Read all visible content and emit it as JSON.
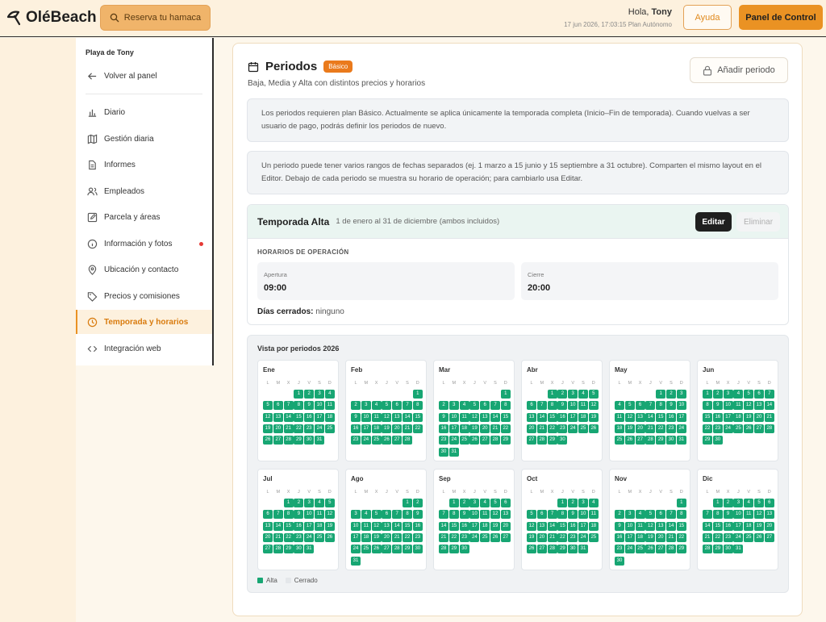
{
  "brand": {
    "name": "OléBeach"
  },
  "header": {
    "reserve_label": "Reserva tu hamaca",
    "greeting_prefix": "Hola,",
    "user_name": "Tony",
    "datetime": "17 jun 2026, 17:03:15",
    "plan": "Plan Autónomo",
    "help_label": "Ayuda",
    "panel_label": "Panel de Control"
  },
  "sidebar": {
    "title": "Playa de Tony",
    "back_label": "Volver al panel",
    "items": [
      {
        "label": "Diario",
        "icon": "bar-chart-icon"
      },
      {
        "label": "Gestión diaria",
        "icon": "map-icon"
      },
      {
        "label": "Informes",
        "icon": "document-icon"
      },
      {
        "label": "Empleados",
        "icon": "users-icon"
      },
      {
        "label": "Parcela y áreas",
        "icon": "edit-icon"
      },
      {
        "label": "Información y fotos",
        "icon": "info-icon"
      },
      {
        "label": "Ubicación y contacto",
        "icon": "location-icon"
      },
      {
        "label": "Precios y comisiones",
        "icon": "tag-icon"
      },
      {
        "label": "Temporada y horarios",
        "icon": "clock-icon"
      },
      {
        "label": "Integración web",
        "icon": "code-icon"
      }
    ]
  },
  "main": {
    "title": "Periodos",
    "badge": "Básico",
    "subtitle": "Baja, Media y Alta con distintos precios y horarios",
    "add_label": "Añadir periodo",
    "info1": "Los periodos requieren plan Básico. Actualmente se aplica únicamente la temporada completa (Inicio–Fin de temporada). Cuando vuelvas a ser usuario de pago, podrás definir los periodos de nuevo.",
    "info2": "Un periodo puede tener varios rangos de fechas separados (ej. 1 marzo a 15 junio y 15 septiembre a 31 octubre). Comparten el mismo layout en el Editor. Debajo de cada periodo se muestra su horario de operación; para cambiarlo usa Editar.",
    "period": {
      "name": "Temporada Alta",
      "range": "1 de enero al 31 de diciembre (ambos incluidos)",
      "edit_label": "Editar",
      "delete_label": "Eliminar",
      "hours_label": "HORARIOS DE OPERACIÓN",
      "open_label": "Apertura",
      "open_value": "09:00",
      "close_label": "Cierre",
      "close_value": "20:00",
      "closed_label": "Días cerrados:",
      "closed_value": "ninguno"
    },
    "calendar": {
      "title": "Vista por periodos 2026",
      "weekdays": [
        "L",
        "M",
        "X",
        "J",
        "V",
        "S",
        "D"
      ],
      "months": [
        {
          "name": "Ene",
          "offset": 3,
          "days": 31
        },
        {
          "name": "Feb",
          "offset": 6,
          "days": 28
        },
        {
          "name": "Mar",
          "offset": 6,
          "days": 31
        },
        {
          "name": "Abr",
          "offset": 2,
          "days": 30
        },
        {
          "name": "May",
          "offset": 4,
          "days": 31
        },
        {
          "name": "Jun",
          "offset": 0,
          "days": 30
        },
        {
          "name": "Jul",
          "offset": 2,
          "days": 31
        },
        {
          "name": "Ago",
          "offset": 5,
          "days": 31
        },
        {
          "name": "Sep",
          "offset": 1,
          "days": 30
        },
        {
          "name": "Oct",
          "offset": 3,
          "days": 31
        },
        {
          "name": "Nov",
          "offset": 6,
          "days": 30
        },
        {
          "name": "Dic",
          "offset": 1,
          "days": 31
        }
      ],
      "legend_alta": "Alta",
      "legend_closed": "Cerrado",
      "color_alta": "#17a673",
      "color_closed": "#e4e7ea"
    }
  }
}
